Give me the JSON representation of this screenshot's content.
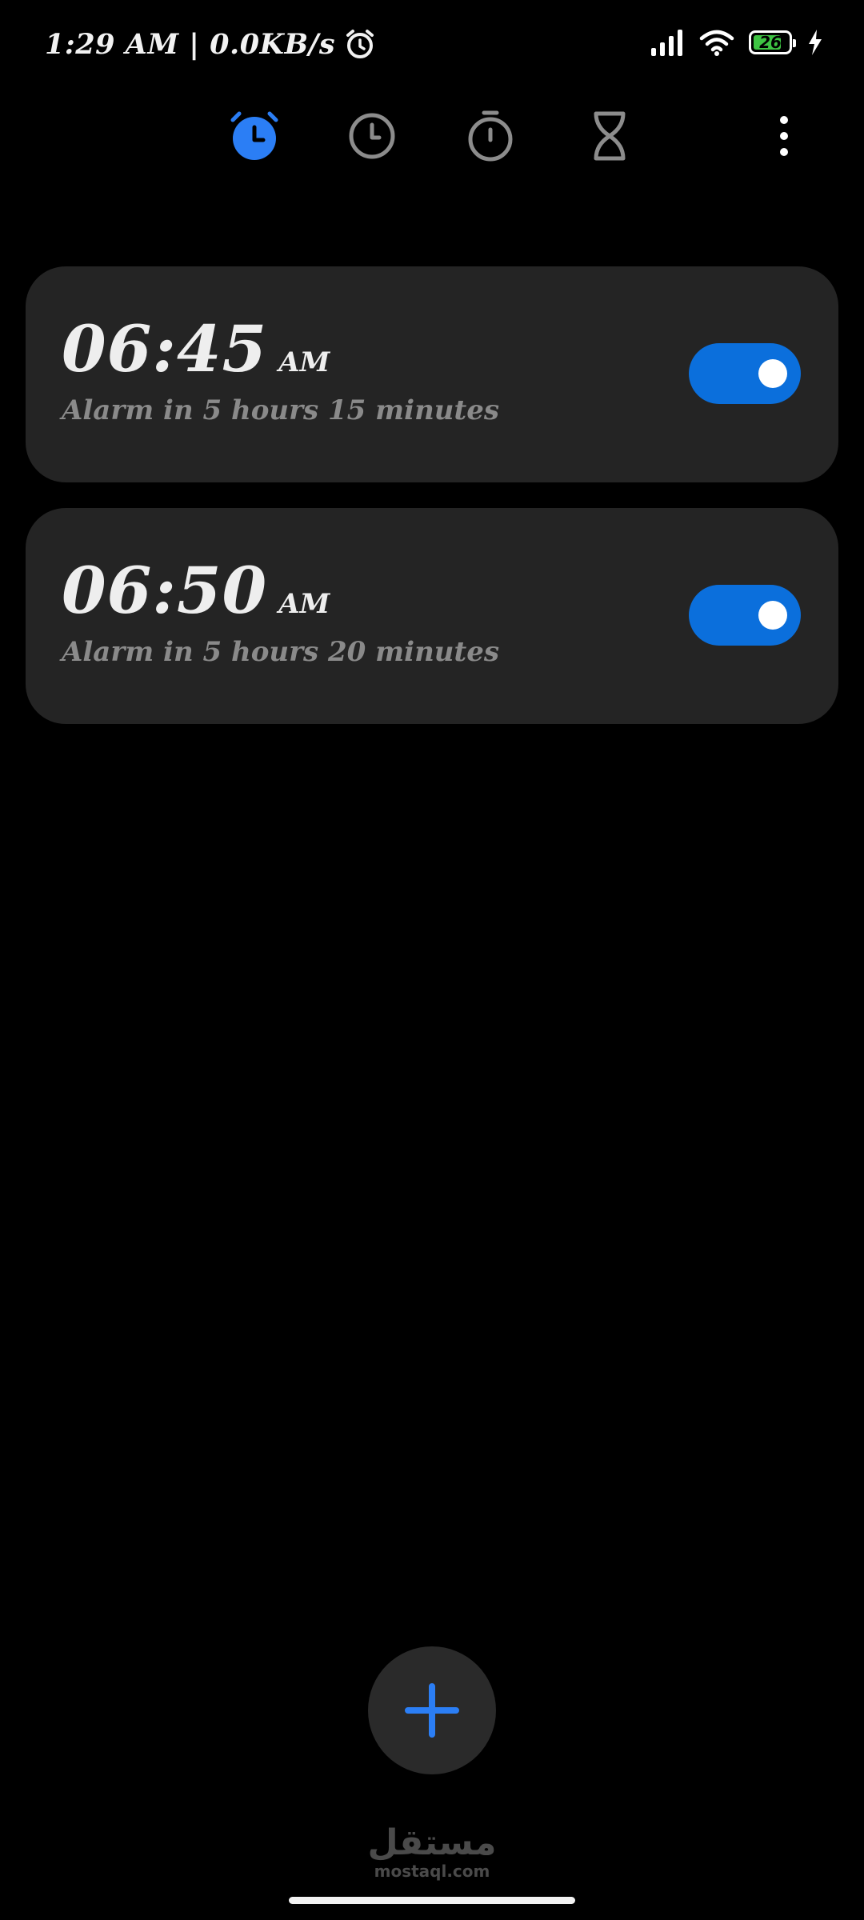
{
  "status_bar": {
    "time_speed": "1:29 AM | 0.0KB/s",
    "battery_level": "26",
    "battery_color": "#3ec443",
    "icons": [
      "alarm-icon",
      "signal-icon",
      "wifi-icon",
      "battery-icon",
      "charging-icon"
    ]
  },
  "tabs": [
    {
      "name": "alarm",
      "icon": "alarm-icon",
      "active": true
    },
    {
      "name": "clock",
      "icon": "clock-icon",
      "active": false
    },
    {
      "name": "stopwatch",
      "icon": "stopwatch-icon",
      "active": false
    },
    {
      "name": "timer",
      "icon": "hourglass-icon",
      "active": false
    }
  ],
  "accent_color": "#2b7ef5",
  "alarms": [
    {
      "time": "06:45",
      "ampm": "AM",
      "subtitle": "Alarm in 5 hours 15 minutes",
      "enabled": true
    },
    {
      "time": "06:50",
      "ampm": "AM",
      "subtitle": "Alarm in 5 hours 20 minutes",
      "enabled": true
    }
  ],
  "fab": {
    "icon": "plus-icon"
  },
  "watermark": {
    "arabic": "مستقل",
    "latin": "mostaql.com"
  }
}
